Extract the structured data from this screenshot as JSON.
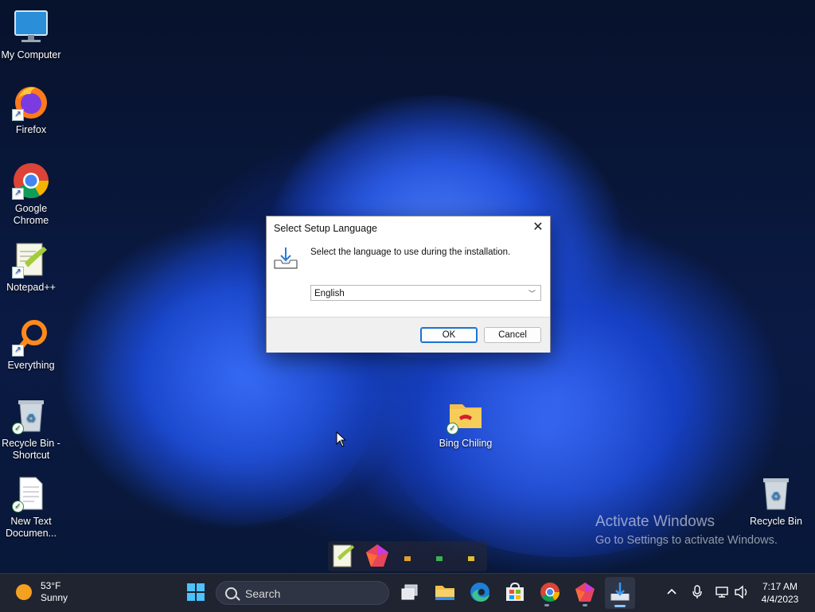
{
  "desktop_icons": [
    {
      "label": "My Computer",
      "icon": "monitor-icon"
    },
    {
      "label": "Firefox",
      "icon": "firefox-icon"
    },
    {
      "label": "Google Chrome",
      "icon": "chrome-icon"
    },
    {
      "label": "Notepad++",
      "icon": "notepadpp-icon"
    },
    {
      "label": "Everything",
      "icon": "everything-icon"
    },
    {
      "label": "Recycle Bin - Shortcut",
      "icon": "recycle-bin-icon"
    },
    {
      "label": "New Text Documen...",
      "icon": "text-file-icon"
    },
    {
      "label": "Bing Chiling",
      "icon": "folder-icon"
    },
    {
      "label": "Recycle Bin",
      "icon": "recycle-bin-icon"
    }
  ],
  "dialog": {
    "title": "Select Setup Language",
    "message": "Select the language to use during the installation.",
    "language_selected": "English",
    "ok_label": "OK",
    "cancel_label": "Cancel"
  },
  "watermark": {
    "line1": "Activate Windows",
    "line2": "Go to Settings to activate Windows."
  },
  "taskbar": {
    "weather_temp": "53°F",
    "weather_cond": "Sunny",
    "search_placeholder": "Search",
    "time": "7:17 AM",
    "date": "4/4/2023"
  },
  "colors": {
    "taskbar_bg": "#1f2430",
    "accent": "#1a73d4",
    "ok_border": "#1a73d4"
  }
}
